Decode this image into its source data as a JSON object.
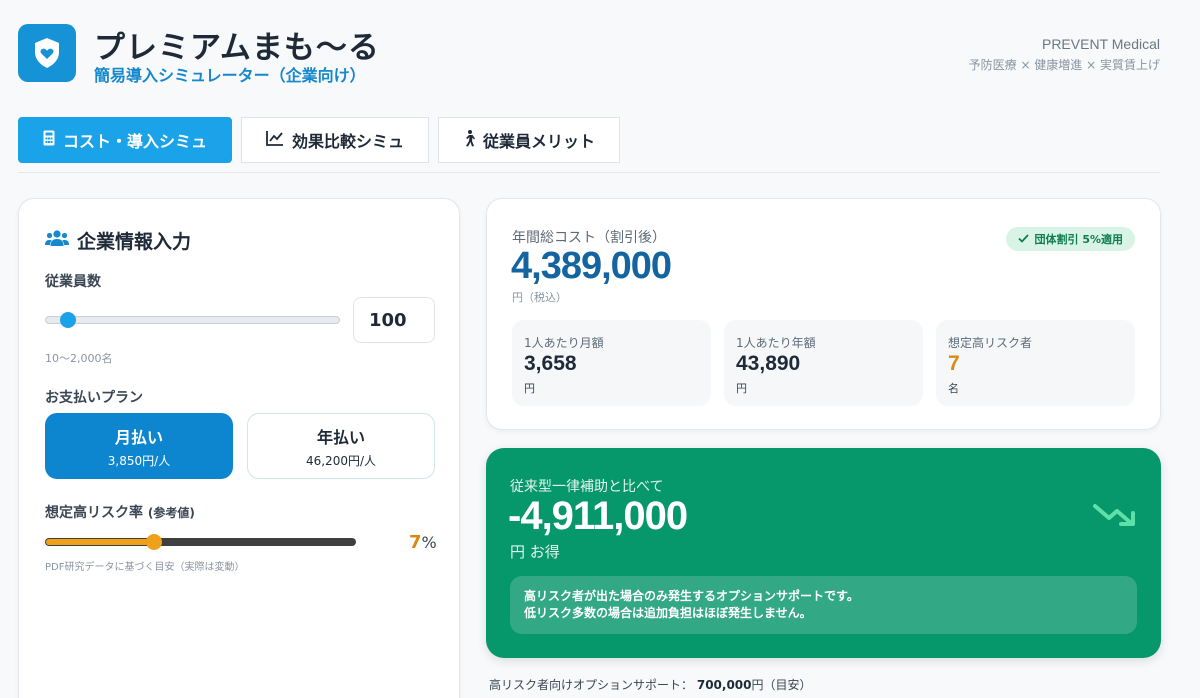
{
  "header": {
    "title": "プレミアムまも〜る",
    "subtitle": "簡易導入シミュレーター（企業向け）",
    "brand": "PREVENT Medical",
    "tagline": "予防医療 × 健康増進 × 実質賃上げ",
    "logo_icon": "shield-heart-icon",
    "accent_color": "#1593d6"
  },
  "tabs": [
    {
      "label": "コスト・導入シミュ",
      "icon": "calculator-icon",
      "active": true
    },
    {
      "label": "効果比較シミュ",
      "icon": "line-chart-icon",
      "active": false
    },
    {
      "label": "従業員メリット",
      "icon": "walking-person-icon",
      "active": false
    }
  ],
  "company_input": {
    "title": "企業情報入力",
    "title_icon": "users-icon",
    "employees": {
      "label": "従業員数",
      "value": "100",
      "range_hint": "10〜2,000名",
      "min": 10,
      "max": 2000,
      "current": 100
    },
    "payment_plan": {
      "label": "お支払いプラン",
      "options": [
        {
          "name": "月払い",
          "price": "3,850円/人",
          "selected": true
        },
        {
          "name": "年払い",
          "price": "46,200円/人",
          "selected": false
        }
      ]
    },
    "risk_rate": {
      "label": "想定高リスク率",
      "label_suffix": "(参考値)",
      "value": "7",
      "unit": "%",
      "hint": "PDF研究データに基づく目安（実際は変動）",
      "fraction": 0.35,
      "color": "#d98a16"
    }
  },
  "summary": {
    "label": "年間総コスト（割引後）",
    "total": "4,389,000",
    "unit": "円（税込）",
    "badge": "団体割引 5%適用",
    "badge_icon": "check-icon",
    "metrics": [
      {
        "label": "1人あたり月額",
        "value": "3,658",
        "unit": "円"
      },
      {
        "label": "1人あたり年額",
        "value": "43,890",
        "unit": "円"
      },
      {
        "label": "想定高リスク者",
        "value": "7",
        "unit": "名"
      }
    ]
  },
  "savings": {
    "label": "従来型一律補助と比べて",
    "amount": "-4,911,000",
    "unit": "円 お得",
    "icon": "trending-down-icon",
    "note_line1_pre": "高リスク者が出た場合のみ発生する",
    "note_line1_bold": "オプションサポート",
    "note_line1_post": "です。",
    "note_line2": "低リスク多数の場合は追加負担はほぼ発生しません。",
    "bg_color": "#06976a"
  },
  "footer": {
    "label": "高リスク者向けオプションサポート：",
    "amount": "700,000",
    "suffix": "円（目安）"
  }
}
